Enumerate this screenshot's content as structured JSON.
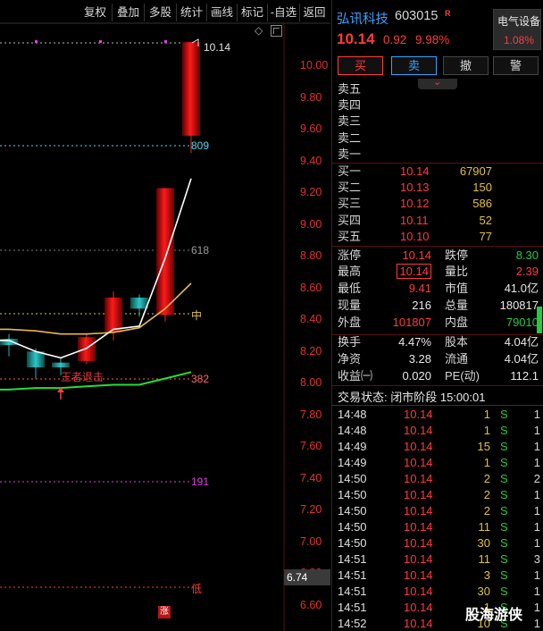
{
  "toolbar": {
    "items": [
      "复权",
      "叠加",
      "多股",
      "统计",
      "画线",
      "标记",
      "-自选",
      "返回"
    ]
  },
  "chart": {
    "price_ticks": [
      "10.00",
      "9.80",
      "9.60",
      "9.40",
      "9.20",
      "9.00",
      "8.80",
      "8.60",
      "8.40",
      "8.20",
      "8.00",
      "7.80",
      "7.60",
      "7.40",
      "7.20",
      "7.00",
      "6.80",
      "6.60"
    ],
    "max_label": "10.14",
    "fib_809": "809",
    "fib_618": "618",
    "fib_mid": "中",
    "fib_382": "382",
    "fib_191": "191",
    "fib_low": "低",
    "signal": "王者退击",
    "price_tag": "6.74",
    "rise_tag": "涨",
    "candles": [
      {
        "o": 8.27,
        "c": 8.23,
        "h": 8.3,
        "l": 8.16
      },
      {
        "o": 8.19,
        "c": 8.09,
        "h": 8.21,
        "l": 8.02
      },
      {
        "o": 8.12,
        "c": 8.09,
        "h": 8.15,
        "l": 8.04
      },
      {
        "o": 8.13,
        "c": 8.28,
        "h": 8.3,
        "l": 8.11
      },
      {
        "o": 8.31,
        "c": 8.53,
        "h": 8.57,
        "l": 8.26
      },
      {
        "o": 8.53,
        "c": 8.46,
        "h": 8.55,
        "l": 8.41
      },
      {
        "o": 8.42,
        "c": 9.22,
        "h": 9.22,
        "l": 8.38
      },
      {
        "o": 9.55,
        "c": 10.14,
        "h": 10.14,
        "l": 9.44
      }
    ],
    "ma_white": [
      8.26,
      8.19,
      8.15,
      8.21,
      8.33,
      8.35,
      8.78,
      9.28
    ],
    "ma_yellow": [
      8.33,
      8.32,
      8.3,
      8.3,
      8.31,
      8.34,
      8.46,
      8.62
    ],
    "ma_green": [
      7.95,
      7.96,
      7.96,
      7.97,
      7.98,
      7.98,
      8.02,
      8.06
    ]
  },
  "header": {
    "name": "弘讯科技",
    "code": "603015",
    "mark": "R",
    "price": "10.14",
    "change": "0.92",
    "pct": "9.98%",
    "sector_name": "电气设备",
    "sector_pct": "1.08%"
  },
  "actions": [
    "买",
    "卖",
    "撤",
    "警"
  ],
  "asks": [
    {
      "label": "卖五",
      "price": "",
      "vol": ""
    },
    {
      "label": "卖四",
      "price": "",
      "vol": ""
    },
    {
      "label": "卖三",
      "price": "",
      "vol": ""
    },
    {
      "label": "卖二",
      "price": "",
      "vol": ""
    },
    {
      "label": "卖一",
      "price": "",
      "vol": ""
    }
  ],
  "bids": [
    {
      "label": "买一",
      "price": "10.14",
      "vol": "67907"
    },
    {
      "label": "买二",
      "price": "10.13",
      "vol": "150"
    },
    {
      "label": "买三",
      "price": "10.12",
      "vol": "586"
    },
    {
      "label": "买四",
      "price": "10.11",
      "vol": "52"
    },
    {
      "label": "买五",
      "price": "10.10",
      "vol": "77"
    }
  ],
  "stats": [
    {
      "l": "涨停",
      "lv": "10.14",
      "r": "跌停",
      "rv": "8.30"
    },
    {
      "l": "最高",
      "lv": "10.14",
      "r": "量比",
      "rv": "2.39"
    },
    {
      "l": "最低",
      "lv": "9.41",
      "r": "市值",
      "rv": "41.0亿"
    },
    {
      "l": "现量",
      "lv": "216",
      "r": "总量",
      "rv": "180817"
    },
    {
      "l": "外盘",
      "lv": "101807",
      "r": "内盘",
      "rv": "79010"
    }
  ],
  "stats2": [
    {
      "l": "换手",
      "lv": "4.47%",
      "r": "股本",
      "rv": "4.04亿"
    },
    {
      "l": "净资",
      "lv": "3.28",
      "r": "流通",
      "rv": "4.04亿"
    },
    {
      "l": "收益㈠",
      "lv": "0.020",
      "r": "PE(动)",
      "rv": "112.1"
    }
  ],
  "trade_status": "交易状态: 闭市阶段 15:00:01",
  "ticks": [
    {
      "t": "14:48",
      "p": "10.14",
      "v": "1",
      "s": "S",
      "n": "1"
    },
    {
      "t": "14:48",
      "p": "10.14",
      "v": "1",
      "s": "S",
      "n": "1"
    },
    {
      "t": "14:49",
      "p": "10.14",
      "v": "15",
      "s": "S",
      "n": "1"
    },
    {
      "t": "14:49",
      "p": "10.14",
      "v": "1",
      "s": "S",
      "n": "1"
    },
    {
      "t": "14:50",
      "p": "10.14",
      "v": "2",
      "s": "S",
      "n": "2"
    },
    {
      "t": "14:50",
      "p": "10.14",
      "v": "2",
      "s": "S",
      "n": "1"
    },
    {
      "t": "14:50",
      "p": "10.14",
      "v": "2",
      "s": "S",
      "n": "1"
    },
    {
      "t": "14:50",
      "p": "10.14",
      "v": "11",
      "s": "S",
      "n": "1"
    },
    {
      "t": "14:50",
      "p": "10.14",
      "v": "30",
      "s": "S",
      "n": "1"
    },
    {
      "t": "14:51",
      "p": "10.14",
      "v": "11",
      "s": "S",
      "n": "3"
    },
    {
      "t": "14:51",
      "p": "10.14",
      "v": "3",
      "s": "S",
      "n": "1"
    },
    {
      "t": "14:51",
      "p": "10.14",
      "v": "30",
      "s": "S",
      "n": "1"
    },
    {
      "t": "14:51",
      "p": "10.14",
      "v": "1",
      "s": "S",
      "n": "1"
    },
    {
      "t": "14:52",
      "p": "10.14",
      "v": "10",
      "s": "S",
      "n": "1"
    }
  ],
  "watermark": "股海游侠",
  "colors": {
    "up": "#ff3b3b",
    "down": "#27c93f",
    "vol": "#e2c23a",
    "accent": "#3aa2ff"
  }
}
